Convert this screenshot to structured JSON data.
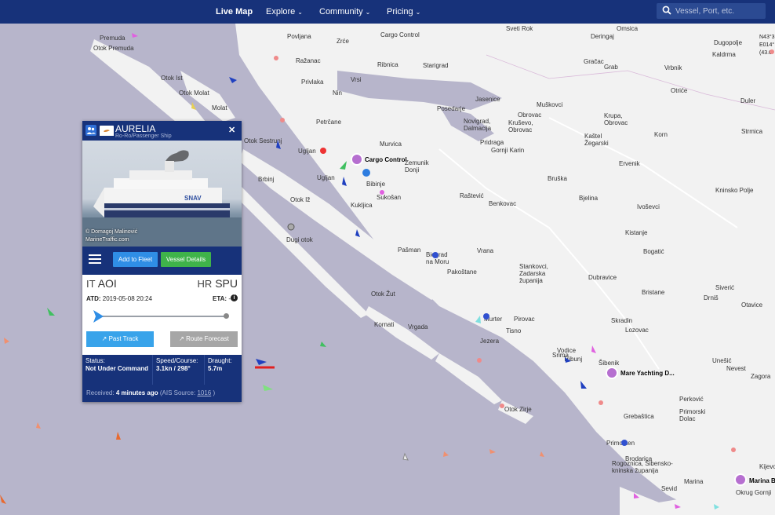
{
  "nav": {
    "live_map": "Live Map",
    "explore": "Explore",
    "community": "Community",
    "pricing": "Pricing",
    "search_placeholder": "Vessel, Port, etc."
  },
  "map": {
    "coords": [
      "N43°3",
      "E014°",
      "(43.6"
    ],
    "places": [
      "Premuda",
      "Otok Premuda",
      "Otok Ist",
      "Otok Molat",
      "Molat",
      "Povljana",
      "Zrće",
      "Cargo Control",
      "Privlaka",
      "Vrsi",
      "Ražanac",
      "Ribnica",
      "Sveti Rok",
      "Deringaj",
      "Omsica",
      "Dugopolje",
      "Kaldrma",
      "Gračac",
      "Grab",
      "Vrbnik",
      "Nin",
      "Starigrad",
      "Posedarje",
      "Jasenice",
      "Muškovci",
      "Duler",
      "Otriće",
      "Obrovac",
      "Krupa, Obrovac",
      "Kaštel Žegarski",
      "Petrčane",
      "Novigrad, Dalmacija",
      "Kruševo, Obrovac",
      "Otok Sestrunj",
      "Murvica",
      "Pridraga",
      "Gornji Karin",
      "Korn",
      "Strmica",
      "Ugljan",
      "Zemunik Donji",
      "Ervenik",
      "Brbinj",
      "Ugljan",
      "Bibinje",
      "Bruška",
      "Kninsko Polje",
      "Sukošan",
      "Raštević",
      "Bjelina",
      "Otok Iž",
      "Kukljica",
      "Benkovac",
      "Ivoševci",
      "Dugi otok",
      "Kistanje",
      "Vrana",
      "Bogatić",
      "Pašman",
      "Biograd na Moru",
      "Pakoštane",
      "Stankovci, Zadarska županija",
      "Otok Žut",
      "Dubravice",
      "Bristane",
      "Siverić",
      "Drniš",
      "Otavice",
      "Kornati",
      "Pirovac",
      "Skradin",
      "Tisno",
      "Lozovac",
      "Vodice",
      "Šibenik",
      "Mare Yachting D...",
      "Unešić",
      "Nevest",
      "Zagora",
      "Tribunj",
      "Otok Zirje",
      "Grebaštica",
      "Perković",
      "Primorski Dolac",
      "Primošten",
      "Rogoznica, Šibensko-kninska županija",
      "Marina",
      "Marina Ba",
      "Sevid",
      "Okrug Gornji",
      "Srima",
      "Jezera",
      "Murter",
      "Brodarica",
      "Kijevo",
      "Vrgada"
    ]
  },
  "panel": {
    "name": "AURELIA",
    "type": "Ro-Ro/Passenger Ship",
    "photo_credit_1": "© Domagoj Malinović",
    "photo_credit_2": "MarineTraffic.com",
    "add_to_fleet": "Add to Fleet",
    "vessel_details": "Vessel Details",
    "dep_country": "IT",
    "dep_port": "AOI",
    "arr_country": "HR",
    "arr_port": "SPU",
    "atd_label": "ATD:",
    "atd_value": "2019-05-08 20:24",
    "eta_label": "ETA:",
    "eta_value": "-",
    "past_track": "Past Track",
    "route_forecast": "Route Forecast",
    "status_label": "Status:",
    "status_value": "Under Command",
    "status_prefix": "Not",
    "speed_label": "Speed/Course:",
    "speed_value": "3.1kn / 298°",
    "draught_label": "Draught:",
    "draught_value": "5.7m",
    "received_label": "Received:",
    "received_value": "4 minutes ago",
    "ais_label": "(AIS Source:",
    "ais_value": "1016",
    "ais_close": ")",
    "progress": 0
  },
  "colors": {
    "nav_bg": "#17327a",
    "sea": "#b7b5cb",
    "land": "#f2f2f2",
    "btn_blue": "#2f8ee6",
    "btn_green": "#3fb34a"
  }
}
